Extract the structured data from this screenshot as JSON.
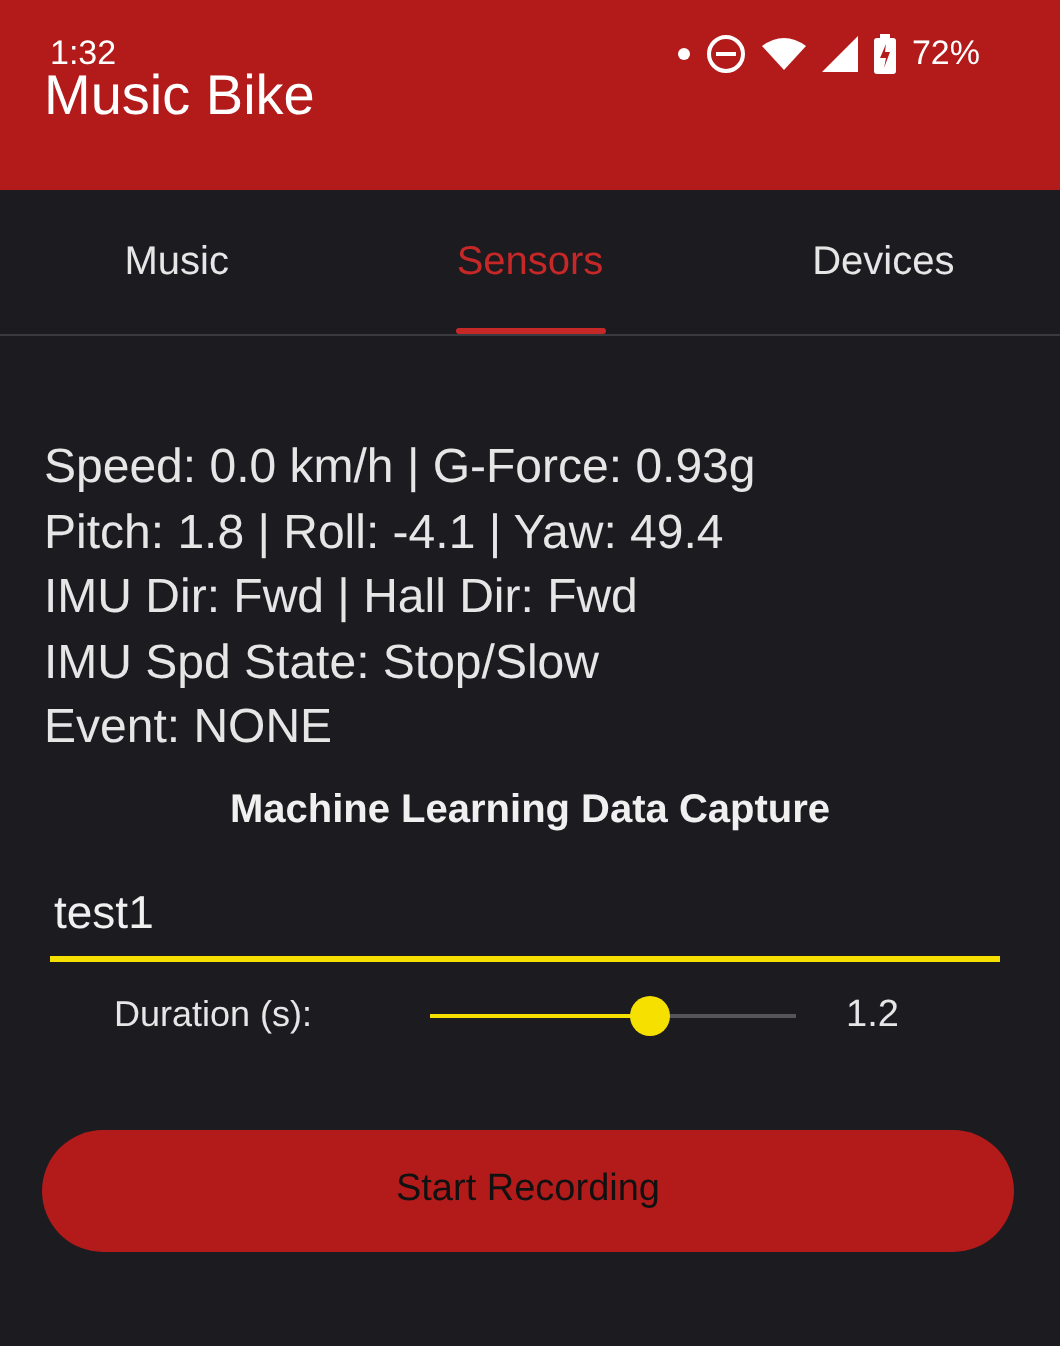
{
  "status_bar": {
    "time": "1:32",
    "battery": "72%"
  },
  "app_bar": {
    "title": "Music Bike"
  },
  "tabs": [
    {
      "label": "Music",
      "selected": false
    },
    {
      "label": "Sensors",
      "selected": true
    },
    {
      "label": "Devices",
      "selected": false
    }
  ],
  "readings": [
    "Speed: 0.0 km/h | G-Force: 0.93g",
    "Pitch: 1.8 | Roll: -4.1 | Yaw: 49.4",
    "IMU Dir: Fwd | Hall Dir: Fwd",
    "IMU Spd State: Stop/Slow",
    "Event: NONE"
  ],
  "capture": {
    "heading": "Machine Learning Data Capture",
    "name_field": {
      "value": "test1"
    },
    "duration": {
      "label": "Duration (s):",
      "level": 0.6,
      "reading": "1.2"
    },
    "button": "Start Recording"
  }
}
